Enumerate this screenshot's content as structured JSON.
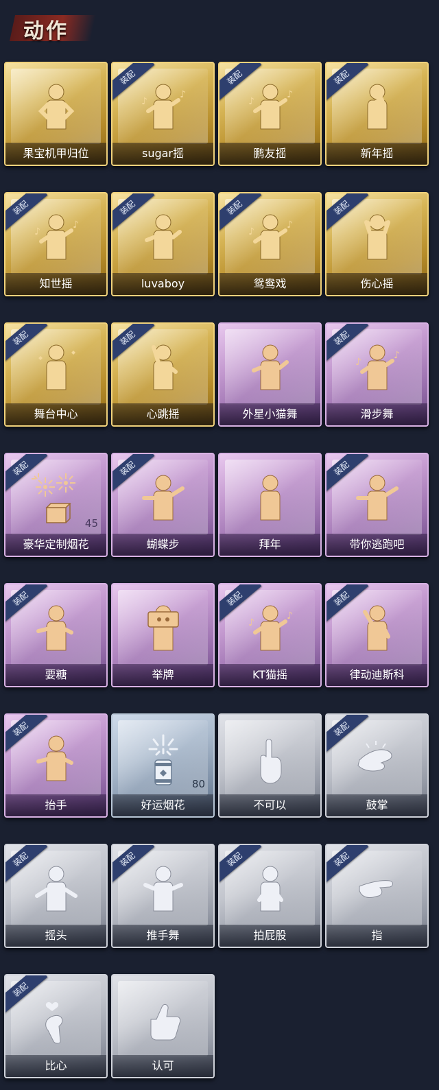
{
  "header": {
    "title": "动作"
  },
  "colors": {
    "gold": "#d6b455",
    "purple": "#c49ad0",
    "blue": "#a9b9cc",
    "gray": "#c2c5cd",
    "badge": "#2e3f6e"
  },
  "items": [
    {
      "name": "果宝机甲归位",
      "tier": "gold",
      "equipped": false,
      "icon": "hands-on-hips-pose-icon"
    },
    {
      "name": "sugar摇",
      "tier": "gold",
      "equipped": true,
      "icon": "music-sway-pose-icon"
    },
    {
      "name": "鹏友摇",
      "tier": "gold",
      "equipped": true,
      "icon": "music-sway-pose-icon"
    },
    {
      "name": "新年摇",
      "tier": "gold",
      "equipped": true,
      "icon": "clap-pose-icon"
    },
    {
      "name": "知世摇",
      "tier": "gold",
      "equipped": true,
      "icon": "music-sway-pose-icon"
    },
    {
      "name": "luvaboy",
      "tier": "gold",
      "equipped": true,
      "icon": "arm-cross-pose-icon"
    },
    {
      "name": "鸳鸯戏",
      "tier": "gold",
      "equipped": true,
      "icon": "music-sway-pose-icon"
    },
    {
      "name": "伤心摇",
      "tier": "gold",
      "equipped": true,
      "icon": "heart-hands-pose-icon"
    },
    {
      "name": "舞台中心",
      "tier": "gold",
      "equipped": true,
      "icon": "sparkle-pose-icon"
    },
    {
      "name": "心跳摇",
      "tier": "gold",
      "equipped": true,
      "icon": "hand-raise-pose-icon"
    },
    {
      "name": "外星小猫舞",
      "tier": "purple",
      "equipped": false,
      "icon": "arm-cross-pose-icon"
    },
    {
      "name": "滑步舞",
      "tier": "purple",
      "equipped": true,
      "icon": "music-sway-pose-icon"
    },
    {
      "name": "豪华定制烟花",
      "tier": "purple",
      "equipped": true,
      "icon": "fireworks-box-icon",
      "count": "45"
    },
    {
      "name": "蝴蝶步",
      "tier": "purple",
      "equipped": true,
      "icon": "point-pose-icon"
    },
    {
      "name": "拜年",
      "tier": "purple",
      "equipped": false,
      "icon": "bow-pose-icon"
    },
    {
      "name": "带你逃跑吧",
      "tier": "purple",
      "equipped": true,
      "icon": "point-pose-icon"
    },
    {
      "name": "要糖",
      "tier": "purple",
      "equipped": true,
      "icon": "reach-pose-icon"
    },
    {
      "name": "举牌",
      "tier": "purple",
      "equipped": false,
      "icon": "hold-sign-pose-icon"
    },
    {
      "name": "KT猫摇",
      "tier": "purple",
      "equipped": true,
      "icon": "music-sway-pose-icon"
    },
    {
      "name": "律动迪斯科",
      "tier": "purple",
      "equipped": true,
      "icon": "disco-pose-icon"
    },
    {
      "name": "抬手",
      "tier": "purple",
      "equipped": true,
      "icon": "reach-pose-icon"
    },
    {
      "name": "好运烟花",
      "tier": "blue",
      "equipped": false,
      "icon": "firework-can-icon",
      "count": "80"
    },
    {
      "name": "不可以",
      "tier": "gray",
      "equipped": false,
      "icon": "finger-wag-icon"
    },
    {
      "name": "鼓掌",
      "tier": "gray",
      "equipped": true,
      "icon": "clap-hands-icon"
    },
    {
      "name": "摇头",
      "tier": "gray",
      "equipped": true,
      "icon": "head-shake-pose-icon"
    },
    {
      "name": "推手舞",
      "tier": "gray",
      "equipped": true,
      "icon": "push-hands-pose-icon"
    },
    {
      "name": "拍屁股",
      "tier": "gray",
      "equipped": true,
      "icon": "bend-pose-icon"
    },
    {
      "name": "指",
      "tier": "gray",
      "equipped": true,
      "icon": "point-hand-icon"
    },
    {
      "name": "比心",
      "tier": "gray",
      "equipped": true,
      "icon": "finger-heart-icon"
    },
    {
      "name": "认可",
      "tier": "gray",
      "equipped": false,
      "icon": "thumbs-up-icon"
    }
  ],
  "equip_label": "装配"
}
